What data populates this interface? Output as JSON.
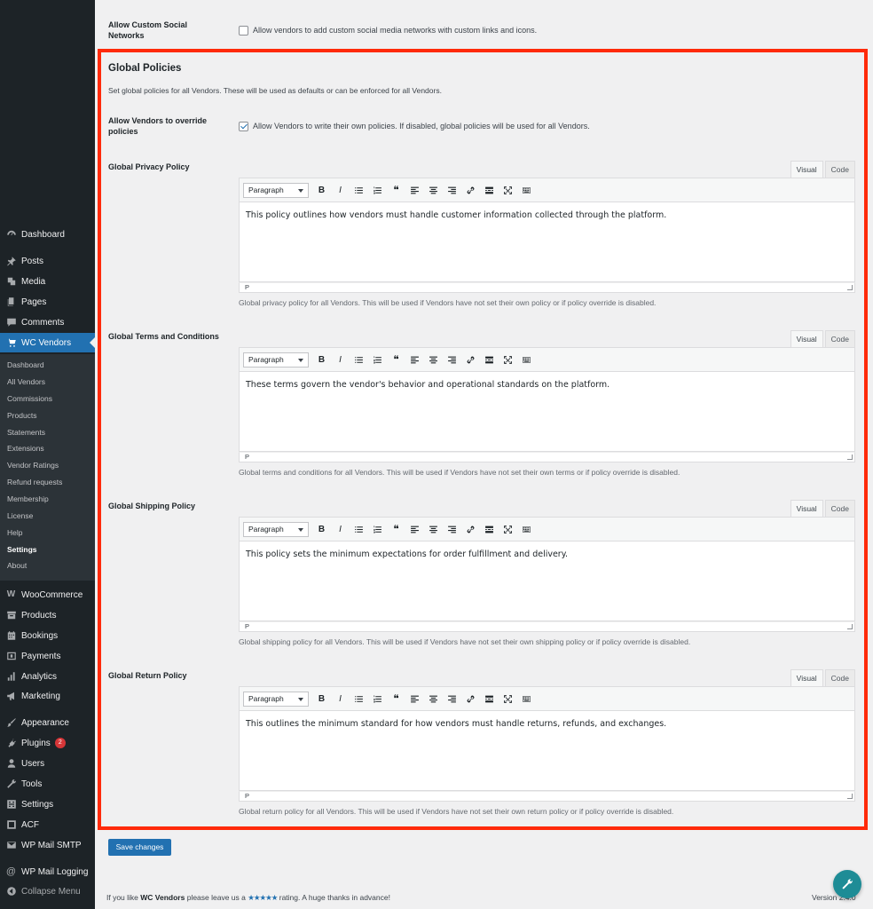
{
  "sidebar": {
    "main_items": [
      {
        "label": "Dashboard",
        "icon": "dashboard-icon"
      },
      {
        "label": "Posts",
        "icon": "pin-icon"
      },
      {
        "label": "Media",
        "icon": "media-icon"
      },
      {
        "label": "Pages",
        "icon": "pages-icon"
      },
      {
        "label": "Comments",
        "icon": "comments-icon"
      },
      {
        "label": "WC Vendors",
        "icon": "cart-icon"
      }
    ],
    "sub_items": [
      {
        "label": "Dashboard"
      },
      {
        "label": "All Vendors"
      },
      {
        "label": "Commissions"
      },
      {
        "label": "Products"
      },
      {
        "label": "Statements"
      },
      {
        "label": "Extensions"
      },
      {
        "label": "Vendor Ratings"
      },
      {
        "label": "Refund requests"
      },
      {
        "label": "Membership"
      },
      {
        "label": "License"
      },
      {
        "label": "Help"
      },
      {
        "label": "Settings"
      },
      {
        "label": "About"
      }
    ],
    "lower_items": [
      {
        "label": "WooCommerce",
        "icon": "woocommerce-icon"
      },
      {
        "label": "Products",
        "icon": "archive-icon"
      },
      {
        "label": "Bookings",
        "icon": "calendar-icon"
      },
      {
        "label": "Payments",
        "icon": "payments-icon"
      },
      {
        "label": "Analytics",
        "icon": "bar-chart-icon"
      },
      {
        "label": "Marketing",
        "icon": "megaphone-icon"
      },
      {
        "label": "Appearance",
        "icon": "paintbrush-icon"
      },
      {
        "label": "Plugins",
        "icon": "plugin-icon",
        "badge": "2"
      },
      {
        "label": "Users",
        "icon": "users-icon"
      },
      {
        "label": "Tools",
        "icon": "wrench-icon"
      },
      {
        "label": "Settings",
        "icon": "settings-icon"
      },
      {
        "label": "ACF",
        "icon": "acf-icon"
      },
      {
        "label": "WP Mail SMTP",
        "icon": "mail-icon"
      },
      {
        "label": "WP Mail Logging",
        "icon": "at-icon"
      },
      {
        "label": "Collapse Menu",
        "icon": "collapse-icon"
      }
    ]
  },
  "top_setting": {
    "label": "Allow Custom Social Networks",
    "checkbox_label": "Allow vendors to add custom social media networks with custom links and icons.",
    "checked": false
  },
  "policies": {
    "title": "Global Policies",
    "description": "Set global policies for all Vendors. These will be used as defaults or can be enforced for all Vendors.",
    "override": {
      "label": "Allow Vendors to override policies",
      "checkbox_label": "Allow Vendors to write their own policies. If disabled, global policies will be used for all Vendors.",
      "checked": true
    },
    "editor_ui": {
      "tab_visual": "Visual",
      "tab_code": "Code",
      "format_select": "Paragraph",
      "status_path": "P"
    },
    "editors": [
      {
        "label": "Global Privacy Policy",
        "content": "This policy outlines how vendors must handle customer information collected through the platform.",
        "help": "Global privacy policy for all Vendors. This will be used if Vendors have not set their own policy or if policy override is disabled."
      },
      {
        "label": "Global Terms and Conditions",
        "content": "These terms govern the vendor's behavior and operational standards on the platform.",
        "help": "Global terms and conditions for all Vendors. This will be used if Vendors have not set their own terms or if policy override is disabled."
      },
      {
        "label": "Global Shipping Policy",
        "content": "This policy sets the minimum expectations for order fulfillment and delivery.",
        "help": "Global shipping policy for all Vendors. This will be used if Vendors have not set their own shipping policy or if policy override is disabled."
      },
      {
        "label": "Global Return Policy",
        "content": "This outlines the minimum standard for how vendors must handle returns, refunds, and exchanges.",
        "help": "Global return policy for all Vendors. This will be used if Vendors have not set their own return policy or if policy override is disabled."
      }
    ]
  },
  "save_button": "Save changes",
  "footer": {
    "text_before": "If you like",
    "brand": "WC Vendors",
    "text_mid": "please leave us a",
    "stars": "★★★★★",
    "text_after": "rating. A huge thanks in advance!",
    "version": "Version 2.4.0"
  },
  "colors": {
    "accent": "#2271b1",
    "sidebar": "#1d2327",
    "highlight": "#ff2a0a"
  }
}
